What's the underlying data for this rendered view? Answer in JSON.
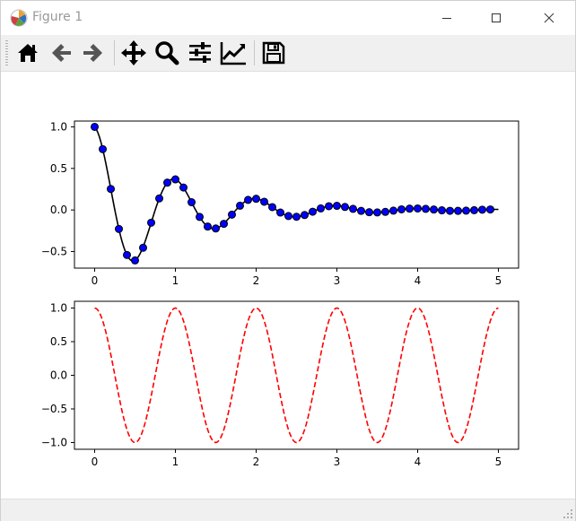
{
  "window": {
    "title": "Figure 1"
  },
  "toolbar": {
    "buttons": [
      {
        "name": "home-icon",
        "tooltip": ""
      },
      {
        "name": "back-arrow-icon",
        "tooltip": ""
      },
      {
        "name": "forward-arrow-icon",
        "tooltip": ""
      },
      {
        "name": "pan-icon",
        "tooltip": ""
      },
      {
        "name": "zoom-icon",
        "tooltip": ""
      },
      {
        "name": "subplots-config-icon",
        "tooltip": ""
      },
      {
        "name": "edit-axes-icon",
        "tooltip": ""
      },
      {
        "name": "save-icon",
        "tooltip": ""
      }
    ]
  },
  "status": {
    "text": ""
  },
  "colors": {
    "line_black": "#000000",
    "marker_blue": "#0000ff",
    "dashed_red": "#ff0000",
    "toolbar_bg": "#f0f0f0"
  },
  "chart_data": [
    {
      "type": "line",
      "title": "",
      "xlabel": "",
      "ylabel": "",
      "xlim": [
        -0.25,
        5.25
      ],
      "ylim": [
        -0.7,
        1.07
      ],
      "xticks": [
        "0",
        "1",
        "2",
        "3",
        "4",
        "5"
      ],
      "yticks": [
        "-0.5",
        "0.0",
        "0.5",
        "1.0"
      ],
      "grid": false,
      "series": [
        {
          "style": "black solid line",
          "formula_samples": "exp(-t)*cos(2*pi*t), t from 0 to 5 step 0.02"
        },
        {
          "style": "blue circle markers",
          "x": [
            0.0,
            0.1,
            0.2,
            0.3,
            0.4,
            0.5,
            0.6,
            0.7,
            0.8,
            0.9,
            1.0,
            1.1,
            1.2,
            1.3,
            1.4,
            1.5,
            1.6,
            1.7,
            1.8,
            1.9,
            2.0,
            2.1,
            2.2,
            2.3,
            2.4,
            2.5,
            2.6,
            2.7,
            2.8,
            2.9,
            3.0,
            3.1,
            3.2,
            3.3,
            3.4,
            3.5,
            3.6,
            3.7,
            3.8,
            3.9,
            4.0,
            4.1,
            4.2,
            4.3,
            4.4,
            4.5,
            4.6,
            4.7,
            4.8,
            4.9
          ],
          "y": [
            1.0,
            0.732,
            0.253,
            -0.229,
            -0.542,
            -0.607,
            -0.455,
            -0.153,
            0.139,
            0.329,
            0.368,
            0.27,
            0.093,
            -0.084,
            -0.2,
            -0.223,
            -0.167,
            -0.056,
            0.051,
            0.121,
            0.135,
            0.099,
            0.034,
            -0.031,
            -0.073,
            -0.082,
            -0.061,
            -0.021,
            0.019,
            0.045,
            0.05,
            0.036,
            0.013,
            -0.011,
            -0.027,
            -0.03,
            -0.023,
            -0.008,
            0.007,
            0.016,
            0.018,
            0.013,
            0.005,
            -0.004,
            -0.01,
            -0.011,
            -0.008,
            -0.003,
            0.003,
            0.006
          ]
        }
      ]
    },
    {
      "type": "line",
      "title": "",
      "xlabel": "",
      "ylabel": "",
      "xlim": [
        -0.25,
        5.25
      ],
      "ylim": [
        -1.1,
        1.1
      ],
      "xticks": [
        "0",
        "1",
        "2",
        "3",
        "4",
        "5"
      ],
      "yticks": [
        "-1.0",
        "-0.5",
        "0.0",
        "0.5",
        "1.0"
      ],
      "grid": false,
      "series": [
        {
          "style": "red dashed line",
          "formula_samples": "cos(2*pi*t), t from 0 to 5 step 0.02"
        }
      ]
    }
  ]
}
